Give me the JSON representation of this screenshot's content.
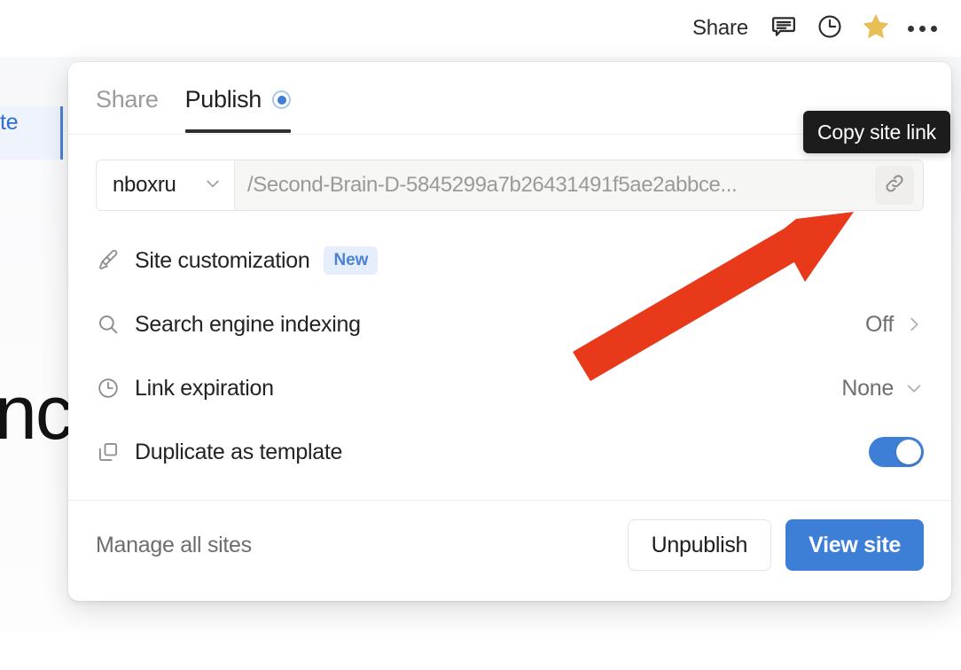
{
  "toolbar": {
    "share_label": "Share",
    "icons": [
      "comment-icon",
      "history-clock-icon",
      "star-icon",
      "more-options-icon"
    ]
  },
  "background": {
    "link_text": "te",
    "page_title_fragment": "nc"
  },
  "modal": {
    "tabs": [
      {
        "label": "Share",
        "active": false
      },
      {
        "label": "Publish",
        "active": true
      }
    ],
    "url_row": {
      "domain": "nboxru",
      "domain_chevron": "chevron-down-icon",
      "path": "/Second-Brain-D-5845299a7b26431491f5ae2abbce...",
      "copy_icon": "link-icon"
    },
    "options": [
      {
        "icon": "paintbrush-icon",
        "label": "Site customization",
        "badge": "New",
        "value": "",
        "control": "badge"
      },
      {
        "icon": "search-icon",
        "label": "Search engine indexing",
        "badge": "",
        "value": "Off",
        "control": "chevron-right"
      },
      {
        "icon": "clock-icon",
        "label": "Link expiration",
        "badge": "",
        "value": "None",
        "control": "chevron-down"
      },
      {
        "icon": "duplicate-icon",
        "label": "Duplicate as template",
        "badge": "",
        "value": "",
        "control": "toggle-on"
      }
    ],
    "footer": {
      "manage_label": "Manage all sites",
      "secondary_button": "Unpublish",
      "primary_button": "View site"
    }
  },
  "tooltip": {
    "text": "Copy site link"
  },
  "annotation": {
    "arrow_color": "#e8391a",
    "arrow_target": "copy-site-link-button"
  },
  "colors": {
    "accent_blue": "#3d7fd6",
    "badge_blue": "#4b82d8",
    "badge_bg": "#e7eefb",
    "star_yellow": "#e8bf57",
    "tooltip_bg": "#1c1c1c",
    "arrow_red": "#e8391a",
    "tab_underline": "#2f2f2f"
  }
}
